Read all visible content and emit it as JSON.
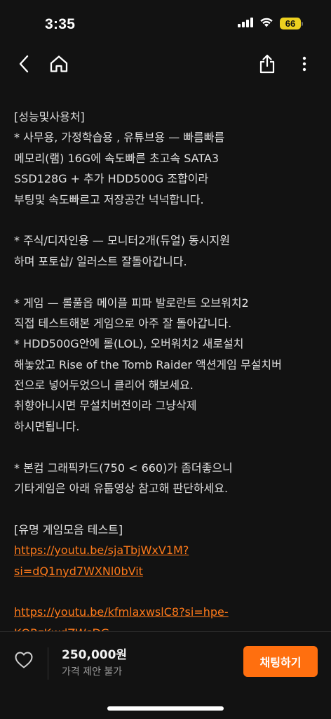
{
  "status_bar": {
    "time": "3:35",
    "battery_level": "66",
    "battery_color": "#ecd01f",
    "icons": [
      "signal-icon",
      "wifi-icon",
      "battery-icon"
    ]
  },
  "nav": {
    "icons": [
      "chevron-left-icon",
      "home-icon",
      "share-icon",
      "more-vertical-icon"
    ]
  },
  "description": {
    "lines": [
      "[성능및사용처]",
      "* 사무용, 가정학습용 , 유튜브용 — 빠름빠름",
      "메모리(램) 16G에 속도빠른 초고속 SATA3",
      "SSD128G + 추가 HDD500G 조합이라",
      "부팅및 속도빠르고 저장공간 넉넉합니다.",
      "",
      "* 주식/디자인용 — 모니터2개(듀얼) 동시지원",
      "하며 포토샵/ 일러스트 잘돌아갑니다.",
      "",
      "* 게임 — 롤풀옵 메이플 피파 발로란트 오브워치2",
      "직접 테스트해본 게임으로 아주 잘 돌아갑니다.",
      "* HDD500G안에 롤(LOL), 오버워치2 새로설치",
      "해놓았고 Rise of the Tomb Raider 액션게임 무설치버",
      "전으로 넣어두었으니 클리어 해보세요.",
      "취향아니시면 무설치버전이라 그냥삭제",
      "하시면됩니다.",
      "",
      "* 본컴 그래픽카드(750 < 660)가 좀더좋으니",
      "기타게임은 아래 유툽영상 참고해 판단하세요.",
      "",
      "[유명 게임모음 테스트]"
    ],
    "links": [
      {
        "line1": "https://youtu.be/sjaTbjWxV1M?",
        "line2": "si=dQ1nyd7WXNl0bVit"
      },
      {
        "line1": "https://youtu.be/kfmlaxwslC8?si=hpe-",
        "line2": "KQRzKwdZWsDG"
      }
    ],
    "link_color": "#ff7a1a"
  },
  "bottom": {
    "price": "250,000원",
    "price_note": "가격 제안 불가",
    "chat_label": "채팅하기",
    "accent": "#ff6f0f",
    "icons": [
      "heart-icon"
    ]
  }
}
